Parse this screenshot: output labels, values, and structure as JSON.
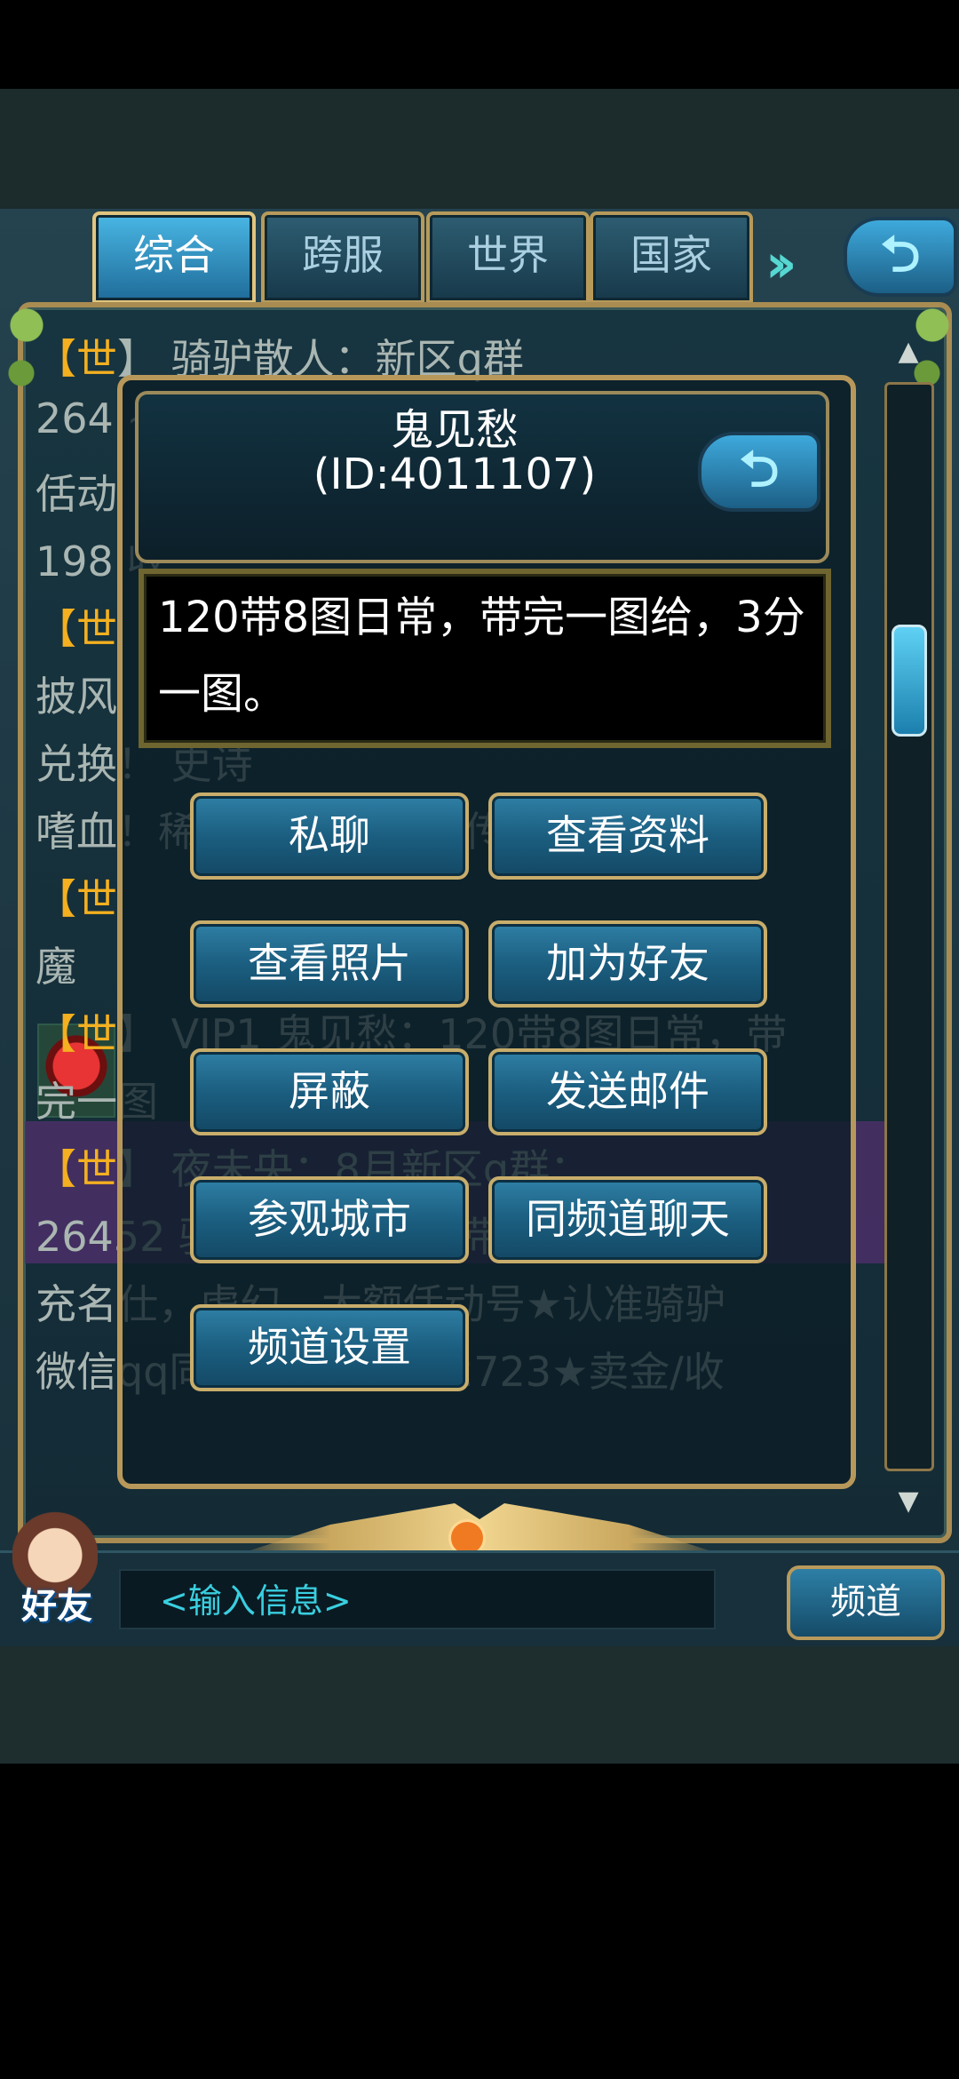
{
  "tabs": [
    "综合",
    "跨服",
    "世界",
    "国家"
  ],
  "active_tab_index": 0,
  "icons": {
    "chevrons": "double-chevron-right-icon",
    "back": "return-arrow-icon",
    "scroll_up": "scroll-up-icon",
    "scroll_down": "scroll-down-icon"
  },
  "chat_background": {
    "lines": [
      {
        "tag": "【世",
        "text": "】      骑驴散人：新区q群"
      },
      {
        "tag": "",
        "text": "264                                                      ~"
      },
      {
        "tag": "",
        "text": "佸动"
      },
      {
        "tag": "",
        "text": "198                                                   收"
      },
      {
        "tag": "【世",
        "text": ""
      },
      {
        "tag": "",
        "text": "披风（普通）收腊八魔法戒指！收宠物"
      },
      {
        "tag": "",
        "text": "兑换！                                                  史诗"
      },
      {
        "tag": "",
        "text": "嗜血！稀有天*狂暴！收传说强化装备"
      },
      {
        "tag": "【世",
        "text": ""
      },
      {
        "tag": "",
        "text": "魔"
      },
      {
        "tag": "【世",
        "text": "】 VIP1 鬼见愁：120带8图日常，带"
      },
      {
        "tag": "",
        "text": "完一图                                             "
      },
      {
        "tag": "【世",
        "text": "】 夜未央：8月新区q群："
      },
      {
        "tag": "",
        "text": "26452          骑驴散人群主售带"
      },
      {
        "tag": "",
        "text": "充名仕，虚幻，大额佸动号★认准骑驴"
      },
      {
        "tag": "",
        "text": "微信qq同号：1984662723★卖金/收"
      }
    ]
  },
  "popup": {
    "player_name": "鬼见愁",
    "player_id": "(ID:4011107)",
    "message": "120带8图日常，带完一图给，3分一图。",
    "buttons": {
      "private_chat": "私聊",
      "view_profile": "查看资料",
      "view_photos": "查看照片",
      "add_friend": "加为好友",
      "block": "屏蔽",
      "send_mail": "发送邮件",
      "visit_city": "参观城市",
      "same_channel_chat": "同频道聊天",
      "channel_settings": "频道设置"
    }
  },
  "bottom": {
    "friends_label": "好友",
    "input_placeholder": "<输入信息>",
    "channel_button": "频道"
  },
  "colors": {
    "gold_border": "#b8985a",
    "button_blue": "#1b5e80",
    "world_tag": "#f4b020",
    "highlight_row": "#4a2f67"
  }
}
